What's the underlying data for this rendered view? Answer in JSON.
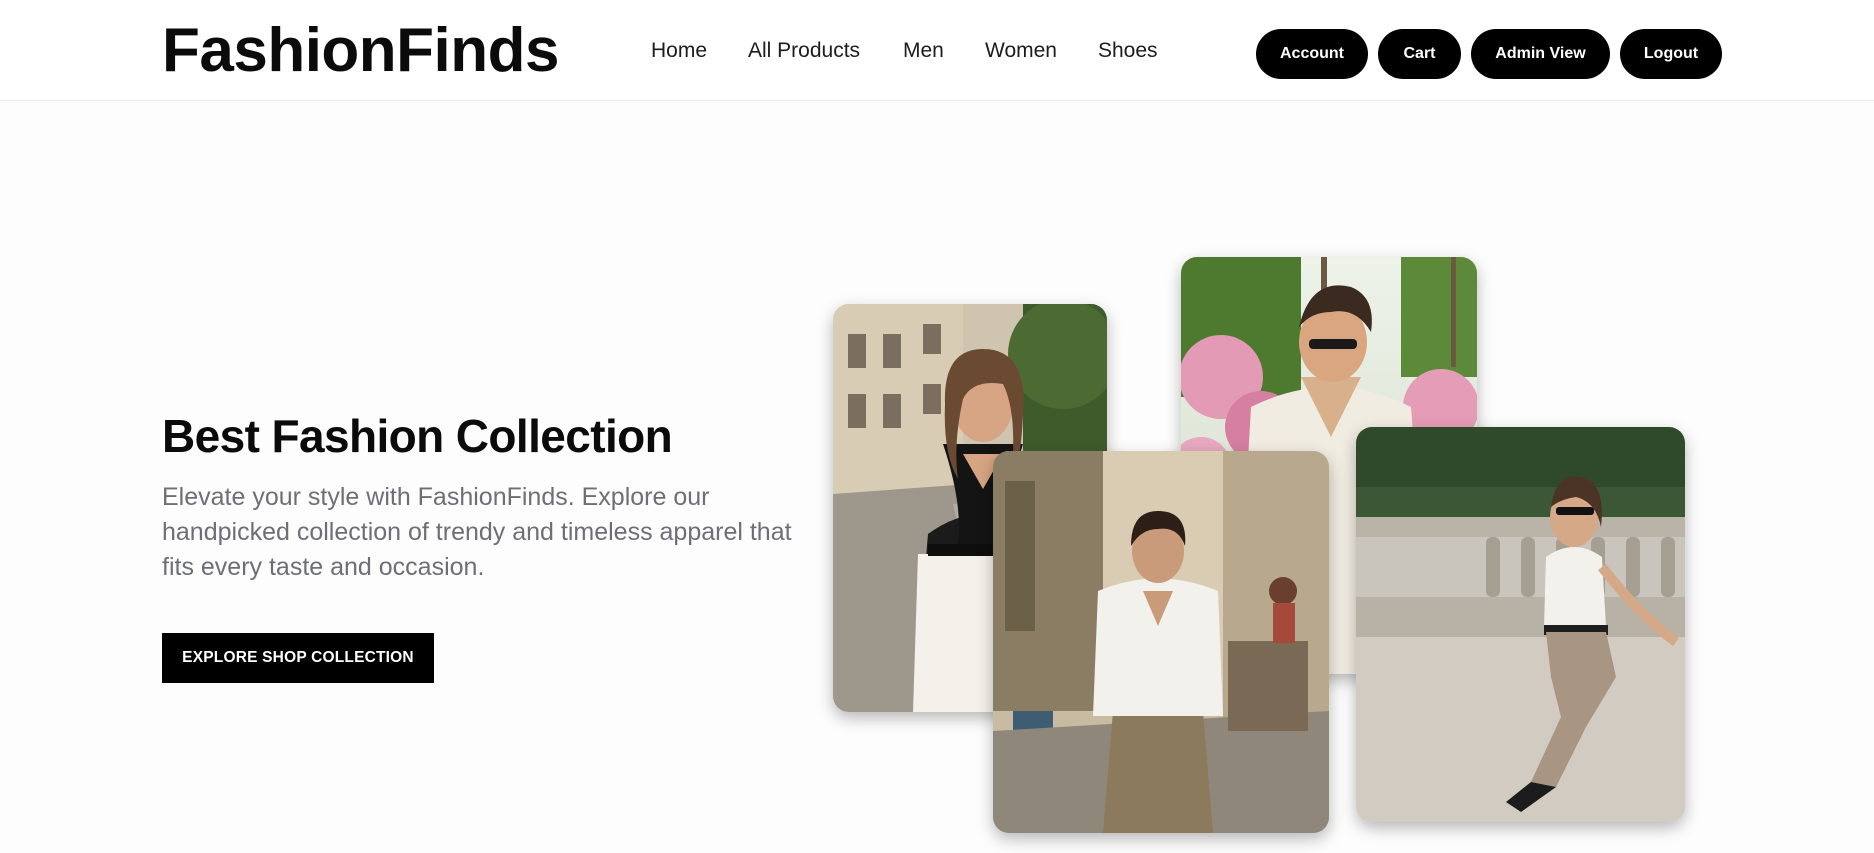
{
  "header": {
    "logo": "FashionFinds",
    "nav": [
      {
        "label": "Home"
      },
      {
        "label": "All Products"
      },
      {
        "label": "Men"
      },
      {
        "label": "Women"
      },
      {
        "label": "Shoes"
      }
    ],
    "buttons": {
      "account": "Account",
      "cart": "Cart",
      "admin_view": "Admin View",
      "logout": "Logout"
    }
  },
  "hero": {
    "title": "Best Fashion Collection",
    "description": "Elevate your style with FashionFinds. Explore our handpicked collection of trendy and timeless apparel that fits every taste and occasion.",
    "cta": "EXPLORE SHOP COLLECTION"
  },
  "colors": {
    "brand": "#000000",
    "text_muted": "#6e6f76",
    "background": "#fdfdfd"
  }
}
